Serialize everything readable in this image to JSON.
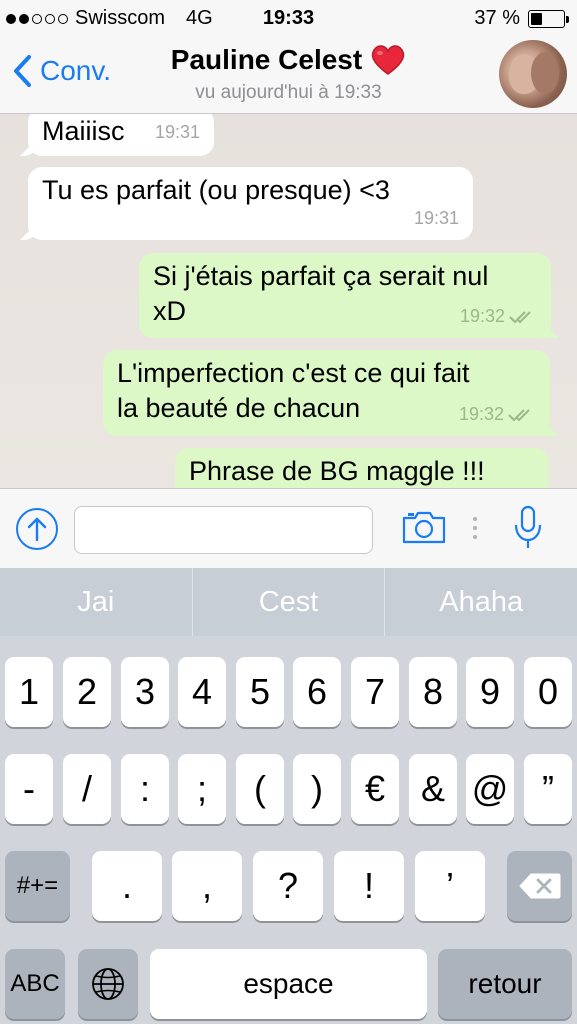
{
  "status_bar": {
    "carrier": "Swisscom",
    "network": "4G",
    "time": "19:33",
    "battery_pct": "37 %",
    "battery_level": 0.37
  },
  "nav": {
    "back_label": "Conv.",
    "title": "Pauline Celest",
    "title_emoji": "❤️",
    "subtitle": "vu aujourd'hui à 19:33"
  },
  "messages": [
    {
      "direction": "in",
      "text": "Maiiisc",
      "time": "19:31",
      "read": false
    },
    {
      "direction": "in",
      "text": "Tu es parfait (ou presque) <3",
      "time": "19:31",
      "read": false
    },
    {
      "direction": "out",
      "line1": "Si j'étais parfait ça serait nul",
      "line2": "xD",
      "time": "19:32",
      "read": true
    },
    {
      "direction": "out",
      "line1": "L'imperfection c'est ce qui fait",
      "line2": "la beauté de chacun",
      "time": "19:32",
      "read": true
    },
    {
      "direction": "out",
      "text": "Phrase de BG maggle !!!",
      "time": "",
      "read": false
    }
  ],
  "input": {
    "value": "",
    "placeholder": ""
  },
  "keyboard": {
    "suggestions": [
      "Jai",
      "Cest",
      "Ahaha"
    ],
    "row1": [
      "1",
      "2",
      "3",
      "4",
      "5",
      "6",
      "7",
      "8",
      "9",
      "0"
    ],
    "row2": [
      "-",
      "/",
      ":",
      ";",
      "(",
      ")",
      "€",
      "&",
      "@",
      "”"
    ],
    "row3_left": "#+=",
    "row3": [
      ".",
      ",",
      "?",
      "!",
      "’"
    ],
    "abc": "ABC",
    "space": "espace",
    "return": "retour"
  },
  "colors": {
    "accent": "#1a7cf2",
    "bubble_out": "#dcf8c6",
    "bubble_in": "#ffffff",
    "heart": "#e8273a"
  },
  "icons": [
    "back-chevron-icon",
    "heart-icon",
    "upload-icon",
    "camera-icon",
    "microphone-icon",
    "globe-icon",
    "backspace-icon",
    "double-check-icon"
  ]
}
